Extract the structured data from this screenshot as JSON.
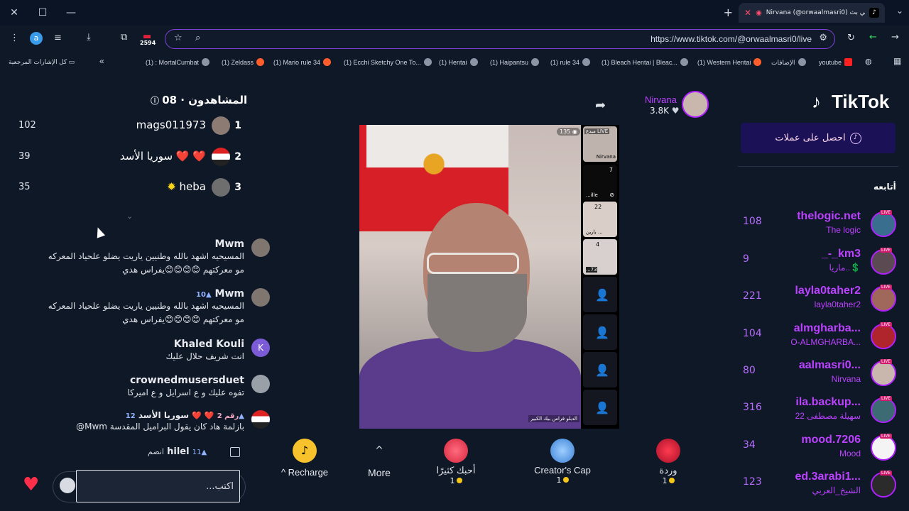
{
  "browser": {
    "tab_title": "Nirvana (@orwaalmasri0) في بث",
    "url": "https://www.tiktok.com/@orwaalmasri0/live",
    "profile_initial": "a",
    "ext_badge": "2594",
    "bookmarks": [
      "youtube",
      "الإضافات",
      "(1) Western Hentai",
      "(1) Bleach Hentai | Bleac...",
      "(1) rule 34",
      "(1) Haipantsu",
      "(1) Hentai",
      "(1) Ecchi Sketchy One To...",
      "(1) Mario rule 34",
      "(1) Zeldass",
      "(1) : MortalCumbat",
      "كل الإشارات المرجعية"
    ]
  },
  "sidebar": {
    "logo": "TikTok",
    "get_coins": "احصل على عملات",
    "following_title": "أتابعه",
    "accounts": [
      {
        "name": "thelogic.net",
        "sub": "The logic",
        "count": "108"
      },
      {
        "name": "_-_km3",
        "sub": "ماريا..💲",
        "count": "9"
      },
      {
        "name": "layla0taher2",
        "sub": "layla0taher2",
        "count": "221"
      },
      {
        "name": "almgharba...",
        "sub": "O-ALMGHARBA...",
        "count": "104"
      },
      {
        "name": "aalmasri0...",
        "sub": "Nirvana",
        "count": "80"
      },
      {
        "name": "ila.backup...",
        "sub": "سهيلة مصطفى 22",
        "count": "316"
      },
      {
        "name": "mood.7206",
        "sub": "Mood",
        "count": "34"
      },
      {
        "name": "ed.3arabi1...",
        "sub": "الشيخ_العربي",
        "count": "123"
      }
    ]
  },
  "stream": {
    "streamer": "Nirvana",
    "likes": "3.8K",
    "view_count": "135",
    "caption": "الدبلو فراس بيك الكبير",
    "guests": [
      {
        "tag": "مبدع LIVE",
        "label": "Nirvana",
        "num": ""
      },
      {
        "tag": "",
        "label": "...ille",
        "num": "7"
      },
      {
        "tag": "",
        "label": "بارين ...",
        "num": "22"
      },
      {
        "tag": "",
        "label": "...73",
        "num": "4"
      }
    ]
  },
  "actions": {
    "recharge": "Recharge",
    "more": "More",
    "gift1": {
      "label": "أحبك كثيرًا",
      "price": "1"
    },
    "gift2": {
      "label": "Creator's Cap",
      "price": "1"
    },
    "gift3": {
      "label": "وردة",
      "price": "1"
    }
  },
  "viewers": {
    "title": "المشاهدون · 08",
    "rows": [
      {
        "rank": "1",
        "name": "mags011973",
        "score": "102"
      },
      {
        "rank": "2",
        "name": "سوريا الأسد ❤️ ❤️",
        "score": "39"
      },
      {
        "rank": "3",
        "name": "heba",
        "score": "35"
      }
    ]
  },
  "chat": [
    {
      "user": "Mwm",
      "level": "",
      "text": "المسيحيه اشهد بالله وطنيين ياريت يضلو علحياد المعركه مو معركتهم 😊😊😊😊يفراس هدي"
    },
    {
      "user": "Mwm",
      "level": "10",
      "text": "المسيحيه اشهد بالله وطنيين ياريت يضلو علحياد المعركه مو معركتهم 😊😊😊😊يفراس هدي"
    },
    {
      "user": "Khaled Kouli",
      "level": "",
      "text": "انت شريف حلال عليك"
    },
    {
      "user": "crownedmusersduet",
      "level": "",
      "text": "تفوه عليك و ع اسرايل و ع اميركا"
    },
    {
      "user": "سوريا الأسد",
      "level": "12",
      "badge": "رقم 2",
      "text": "@Mwm بازلمة هاد كان يقول البراميل المقدسة"
    }
  ],
  "join": {
    "user": "hilel",
    "level": "11",
    "text": "انضم"
  },
  "composer": {
    "placeholder": "اكتب..."
  }
}
